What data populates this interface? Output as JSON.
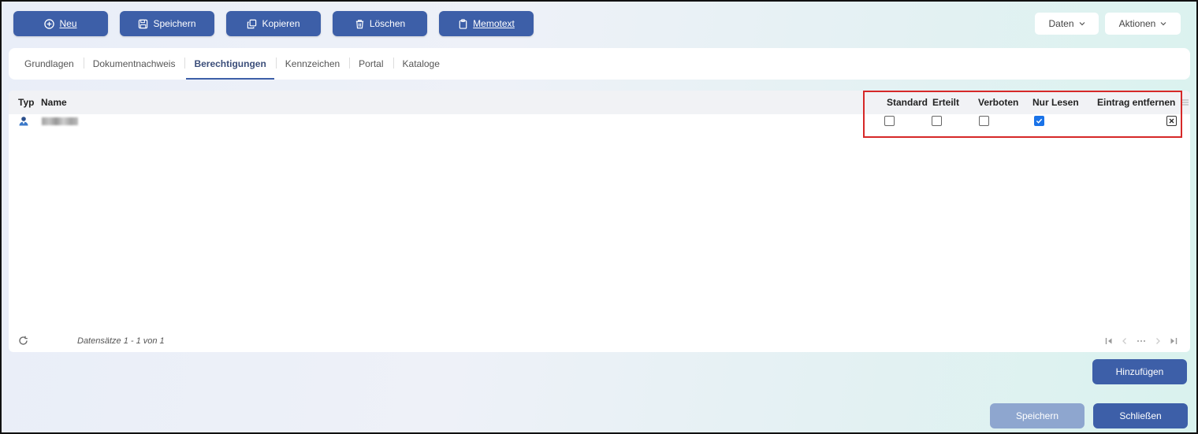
{
  "toolbar": {
    "new": "Neu",
    "save": "Speichern",
    "copy": "Kopieren",
    "delete": "Löschen",
    "memo": "Memotext"
  },
  "topmenu": {
    "data": "Daten",
    "actions": "Aktionen"
  },
  "tabs": [
    {
      "label": "Grundlagen",
      "active": false
    },
    {
      "label": "Dokumentnachweis",
      "active": false
    },
    {
      "label": "Berechtigungen",
      "active": true
    },
    {
      "label": "Kennzeichen",
      "active": false
    },
    {
      "label": "Portal",
      "active": false
    },
    {
      "label": "Kataloge",
      "active": false
    }
  ],
  "grid": {
    "columns": {
      "type": "Typ",
      "name": "Name",
      "standard": "Standard",
      "granted": "Erteilt",
      "forbidden": "Verboten",
      "readonly": "Nur Lesen",
      "remove": "Eintrag entfernen"
    },
    "rows": [
      {
        "type_icon": "user-icon",
        "standard": false,
        "granted": false,
        "forbidden": false,
        "readonly": true
      }
    ],
    "records": "Datensätze 1 - 1 von 1"
  },
  "buttons": {
    "add": "Hinzufügen",
    "save": "Speichern",
    "close": "Schließen"
  },
  "colors": {
    "primary": "#3d5fa8",
    "primary_disabled": "#8ea6cf",
    "highlight": "#d62828"
  }
}
